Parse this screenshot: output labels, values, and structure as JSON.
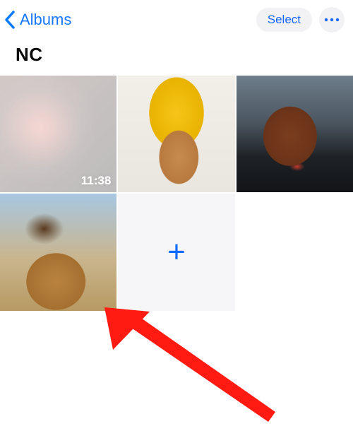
{
  "navbar": {
    "back_label": "Albums",
    "select_label": "Select"
  },
  "album": {
    "title": "NC"
  },
  "grid": {
    "items": [
      {
        "kind": "video",
        "duration": "11:38"
      },
      {
        "kind": "photo"
      },
      {
        "kind": "photo"
      },
      {
        "kind": "photo"
      },
      {
        "kind": "add"
      }
    ]
  },
  "annotation": {
    "arrow_color": "#ff1a12"
  }
}
